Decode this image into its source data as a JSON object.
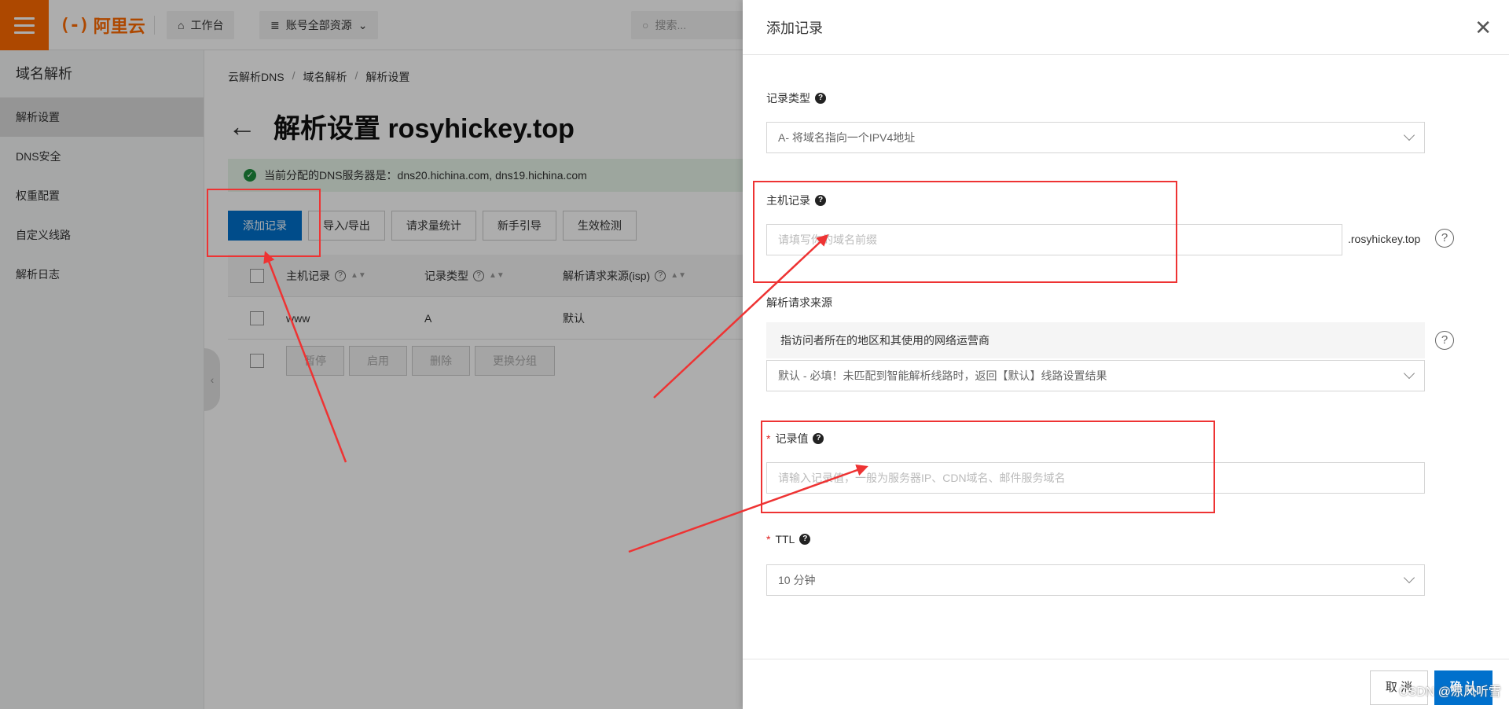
{
  "topbar": {
    "logo_text": "阿里云",
    "logo_mark": "(-)",
    "workbench": "工作台",
    "account_resources": "账号全部资源",
    "search_placeholder": "搜索..."
  },
  "sidebar": {
    "title": "域名解析",
    "items": [
      {
        "label": "解析设置",
        "active": true
      },
      {
        "label": "DNS安全"
      },
      {
        "label": "权重配置"
      },
      {
        "label": "自定义线路"
      },
      {
        "label": "解析日志"
      }
    ]
  },
  "main": {
    "breadcrumb": [
      "云解析DNS",
      "域名解析",
      "解析设置"
    ],
    "title": "解析设置 rosyhickey.top",
    "notice": "当前分配的DNS服务器是：dns20.hichina.com, dns19.hichina.com",
    "toolbar": [
      "添加记录",
      "导入/导出",
      "请求量统计",
      "新手引导",
      "生效检测"
    ],
    "table": {
      "headers": [
        "主机记录",
        "记录类型",
        "解析请求来源(isp)"
      ],
      "rows": [
        [
          "www",
          "A",
          "默认"
        ]
      ]
    },
    "footer_buttons": [
      "暂停",
      "启用",
      "删除",
      "更换分组"
    ]
  },
  "drawer": {
    "title": "添加记录",
    "record_type": {
      "label": "记录类型",
      "value": "A- 将域名指向一个IPV4地址"
    },
    "host_record": {
      "label": "主机记录",
      "placeholder": "请填写你的域名前缀",
      "suffix": ".rosyhickey.top"
    },
    "isp_source": {
      "label": "解析请求来源",
      "hint": "指访问者所在的地区和其使用的网络运营商",
      "value": "默认 - 必填！未匹配到智能解析线路时，返回【默认】线路设置结果"
    },
    "record_value": {
      "label": "记录值",
      "placeholder": "请输入记录值，一般为服务器IP、CDN域名、邮件服务域名"
    },
    "ttl": {
      "label": "TTL",
      "value": "10 分钟"
    },
    "cancel": "取 消",
    "confirm": "确 认"
  },
  "watermark": "CSDN @凉风听雪",
  "colors": {
    "brand": "#ff6a00",
    "primary": "#0070cc",
    "annotation": "#ee3333"
  }
}
